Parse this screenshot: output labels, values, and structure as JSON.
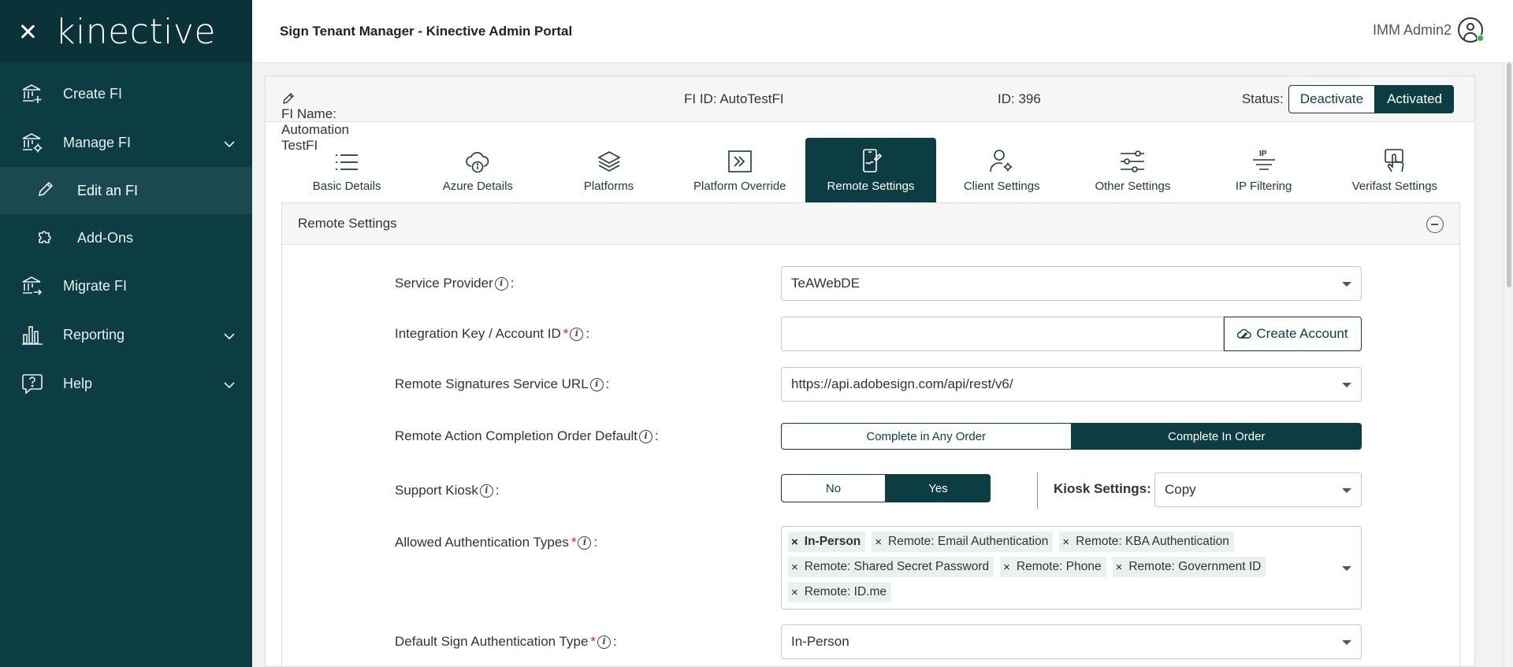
{
  "sidebar": {
    "logo": "kinective",
    "items": [
      {
        "label": "Create FI"
      },
      {
        "label": "Manage FI"
      },
      {
        "label": "Edit an FI"
      },
      {
        "label": "Add-Ons"
      },
      {
        "label": "Migrate FI"
      },
      {
        "label": "Reporting"
      },
      {
        "label": "Help"
      }
    ]
  },
  "header": {
    "title": "Sign Tenant Manager - Kinective Admin Portal",
    "user": "IMM Admin2"
  },
  "fi": {
    "name": "FI Name: Automation TestFI",
    "fi_id": "FI ID: AutoTestFI",
    "id": "ID: 396",
    "status_label": "Status:",
    "deactivate": "Deactivate",
    "activated": "Activated"
  },
  "tabs": [
    {
      "label": "Basic Details"
    },
    {
      "label": "Azure Details"
    },
    {
      "label": "Platforms"
    },
    {
      "label": "Platform Override"
    },
    {
      "label": "Remote Settings"
    },
    {
      "label": "Client Settings"
    },
    {
      "label": "Other Settings"
    },
    {
      "label": "IP Filtering"
    },
    {
      "label": "Verifast Settings"
    }
  ],
  "panel": {
    "title": "Remote Settings",
    "service_provider": {
      "label": "Service Provider",
      "value": "TeAWebDE"
    },
    "integration_key": {
      "label": "Integration Key / Account ID",
      "value": "",
      "button": "Create Account"
    },
    "service_url": {
      "label": "Remote Signatures Service URL",
      "value": "https://api.adobesign.com/api/rest/v6/"
    },
    "completion_order": {
      "label": "Remote Action Completion Order Default",
      "option_any": "Complete in Any Order",
      "option_order": "Complete In Order"
    },
    "support_kiosk": {
      "label": "Support Kiosk",
      "no": "No",
      "yes": "Yes",
      "kiosk_settings_label": "Kiosk Settings:",
      "kiosk_settings_value": "Copy"
    },
    "auth_types": {
      "label": "Allowed Authentication Types",
      "chips": [
        "In-Person",
        "Remote: Email Authentication",
        "Remote: KBA Authentication",
        "Remote: Shared Secret Password",
        "Remote: Phone",
        "Remote: Government ID",
        "Remote: ID.me"
      ]
    },
    "default_auth": {
      "label": "Default Sign Authentication Type",
      "value": "In-Person"
    }
  },
  "common": {
    "colon": ":",
    "required": "*",
    "info": "i",
    "chip_remove": "×"
  },
  "colors": {
    "sidebar": "#0b3d42",
    "accent": "#0b3d42",
    "required": "#dd2222"
  }
}
